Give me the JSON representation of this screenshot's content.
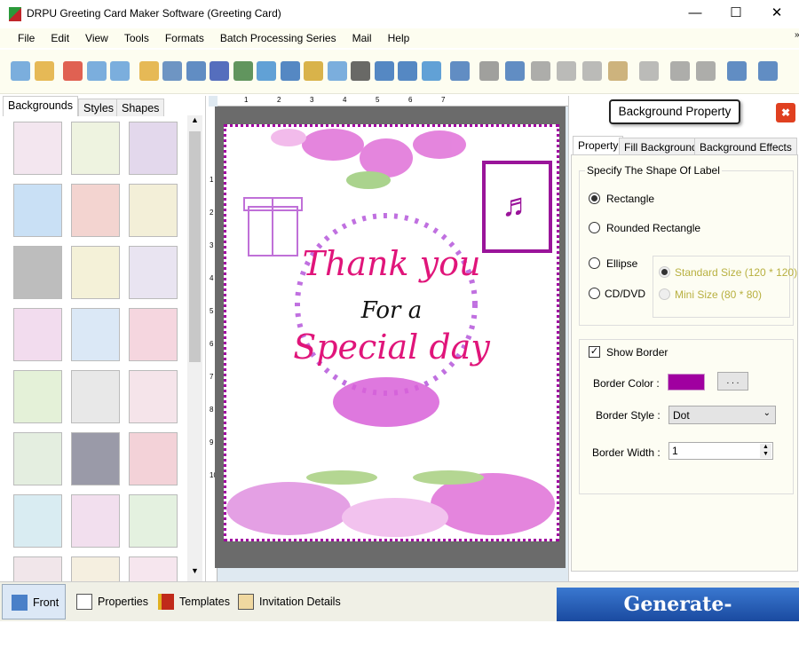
{
  "window": {
    "title": "DRPU Greeting Card Maker Software (Greeting Card)",
    "controls": [
      "minimize",
      "maximize",
      "close"
    ]
  },
  "menu": [
    "File",
    "Edit",
    "View",
    "Tools",
    "Formats",
    "Batch Processing Series",
    "Mail",
    "Help"
  ],
  "toolbar": {
    "icons": [
      "new-icon",
      "open-icon",
      "close-icon",
      "save-icon",
      "save-as-icon",
      "open-template-icon",
      "page-setup-icon",
      "print-icon",
      "layers-icon",
      "background-icon",
      "insert-image-icon",
      "pen-icon",
      "shapes-icon",
      "wordart-icon",
      "barcode-icon",
      "text-icon",
      "signature-icon",
      "email-icon",
      "line-icon",
      "database-icon",
      "undo-icon",
      "redo-icon",
      "cut-icon",
      "copy-icon",
      "paste-icon",
      "delete-icon",
      "bring-front-icon",
      "send-back-icon",
      "grid-icon",
      "actual-size-icon"
    ]
  },
  "left_panel": {
    "tabs": [
      "Backgrounds",
      "Styles",
      "Shapes"
    ],
    "active_tab": "Backgrounds",
    "thumb_colors": [
      "#f3e6ef",
      "#eef3e0",
      "#e3d8ec",
      "#c9e0f5",
      "#f3d4d0",
      "#f3efd8",
      "#bdbdbd",
      "#f4f1d8",
      "#e9e4f1",
      "#f2dcee",
      "#dbe8f6",
      "#f5d6df",
      "#e4f1d8",
      "#e8e8e8",
      "#f5e4ea",
      "#e4eee0",
      "#9a9aa8",
      "#f3d2d8",
      "#d9ecf2",
      "#f2dfee",
      "#e4f1e0",
      "#f1e6ea",
      "#f5efe0",
      "#f6e6ee"
    ]
  },
  "card": {
    "line1": "Thank you",
    "line2": "For a",
    "line3": "Special day",
    "border_color": "#a000a0",
    "accent": "#e0157a"
  },
  "ruler": {
    "top": [
      "1",
      "2",
      "3",
      "4",
      "5",
      "6",
      "7"
    ],
    "left": [
      "1",
      "2",
      "3",
      "4",
      "5",
      "6",
      "7",
      "8",
      "9",
      "10"
    ]
  },
  "right_panel": {
    "title": "Background Property",
    "tabs": [
      "Property",
      "Fill Background",
      "Background Effects"
    ],
    "active_tab": "Property",
    "shape_group_title": "Specify The Shape Of Label",
    "shapes": [
      {
        "label": "Rectangle",
        "selected": true
      },
      {
        "label": "Rounded Rectangle",
        "selected": false
      },
      {
        "label": "Ellipse",
        "selected": false
      },
      {
        "label": "CD/DVD",
        "selected": false
      }
    ],
    "cd_sizes": [
      {
        "label": "Standard Size (120 * 120)",
        "selected": true
      },
      {
        "label": "Mini Size (80 * 80)",
        "selected": false
      }
    ],
    "show_border_label": "Show Border",
    "show_border": true,
    "border_color_label": "Border Color :",
    "border_color": "#a000a0",
    "browse_label": ". . .",
    "border_style_label": "Border Style :",
    "border_style": "Dot",
    "border_width_label": "Border Width :",
    "border_width": "1"
  },
  "bottom_tabs": [
    {
      "label": "Front",
      "active": true
    },
    {
      "label": "Properties"
    },
    {
      "label": "Templates"
    },
    {
      "label": "Invitation Details"
    }
  ],
  "watermark": "Generate-barcode.com"
}
